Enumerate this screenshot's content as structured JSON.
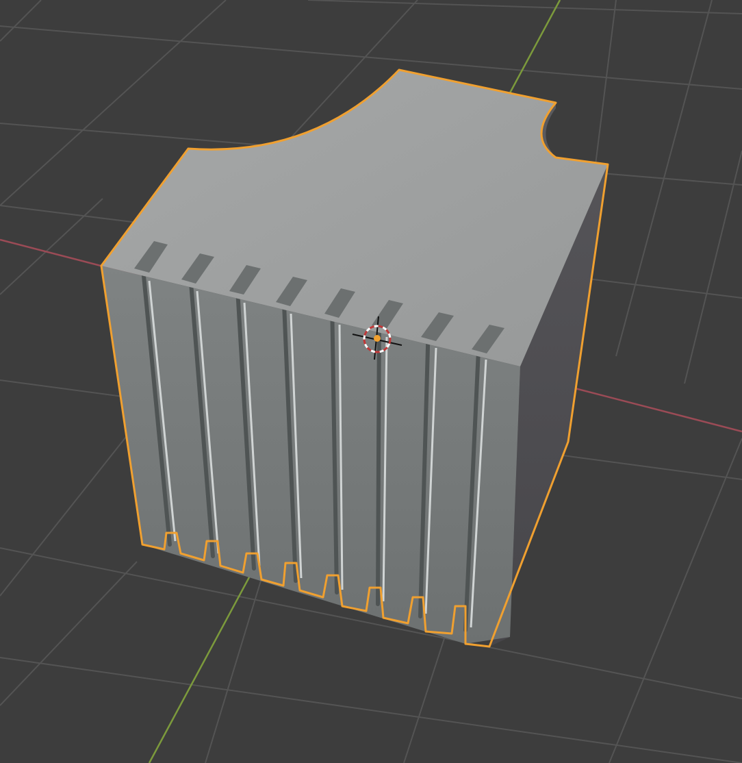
{
  "viewport": {
    "view": "3D Viewport",
    "shading": "solid",
    "background_color": "#3d3d3d",
    "grid_color": "#545454",
    "x_axis_color": "#9b4b56",
    "y_axis_color": "#7c9a3c"
  },
  "selected_object": {
    "shape": "block with vertical grooves and curved top cutouts",
    "groove_count": 8,
    "selected": true,
    "outline_color": "#f0a030",
    "top_face_color": "#a0a2a2",
    "front_face_color": "#767a7a",
    "side_face_color": "#4d4c4f"
  },
  "cursor_3d": {
    "ring_colors": [
      "#c03838",
      "#ffffff"
    ],
    "origin_color": "#f0a030"
  }
}
